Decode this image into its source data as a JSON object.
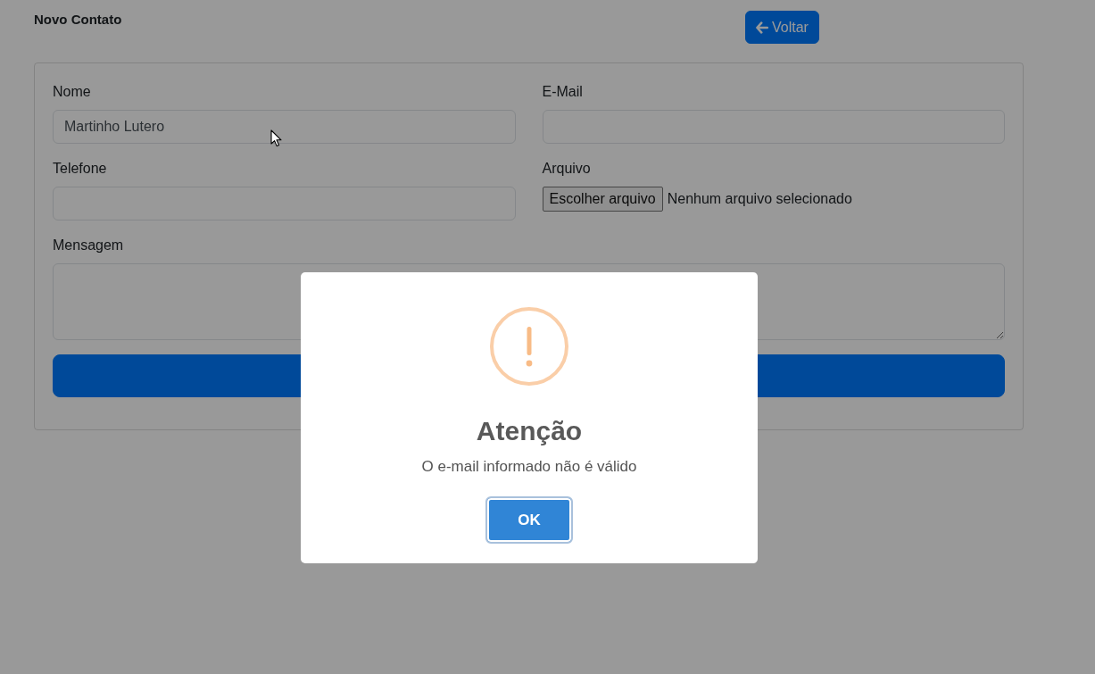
{
  "header": {
    "title": "Novo Contato",
    "back_button": {
      "label": "Voltar"
    }
  },
  "form": {
    "fields": [
      {
        "kind": "text",
        "label": "Nome",
        "value": "Martinho Lutero"
      },
      {
        "kind": "text",
        "label": "E-Mail"
      },
      {
        "kind": "text",
        "label": "Telefone"
      },
      {
        "kind": "file",
        "label": "Arquivo",
        "button": "Escolher arquivo",
        "status": "Nenhum arquivo selecionado"
      },
      {
        "kind": "textarea",
        "label": "Mensagem"
      }
    ],
    "actions": [
      {
        "kind": "submit"
      }
    ]
  },
  "alert": {
    "kind": "warning",
    "title": "Atenção",
    "text": "O e-mail informado não é válido",
    "confirm_button": {
      "label": "OK",
      "focused": true
    }
  }
}
